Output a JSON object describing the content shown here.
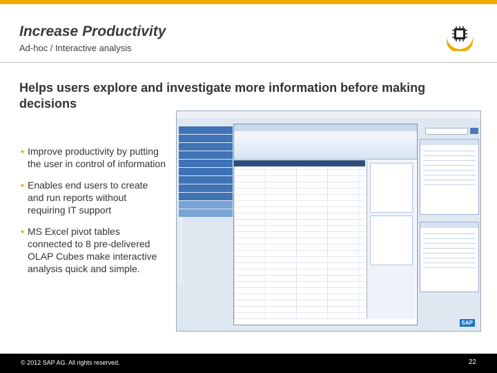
{
  "slide": {
    "title": "Increase Productivity",
    "subtitle": "Ad-hoc / Interactive analysis",
    "headline": "Helps users explore and investigate more information before making decisions",
    "bullets": [
      "Improve productivity by putting the user in control of information",
      "Enables end users to create and run reports without requiring IT support",
      "MS Excel pivot tables connected to 8 pre-delivered OLAP Cubes make interactive analysis quick and simple."
    ],
    "footer": {
      "copyright": "© 2012 SAP AG. All rights reserved.",
      "page_number": "22"
    }
  },
  "colors": {
    "accent": "#f0ab00",
    "footer_bg": "#000000"
  },
  "icons": {
    "logo": "chip-icon",
    "bullet": "bullet-dot"
  },
  "screenshot": {
    "brand": "SAP"
  }
}
